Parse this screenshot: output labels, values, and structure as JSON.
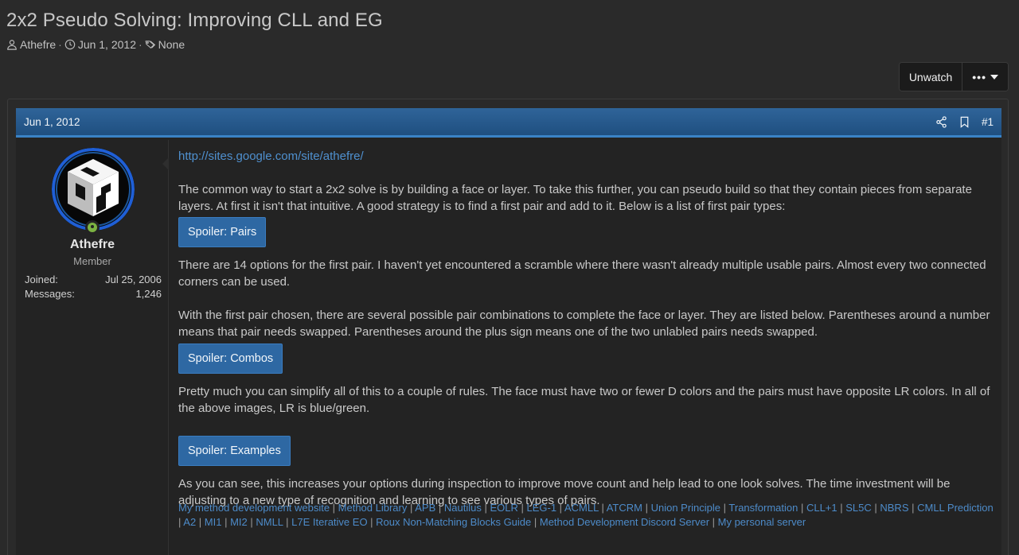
{
  "thread": {
    "title": "2x2 Pseudo Solving: Improving CLL and EG",
    "author": "Athefre",
    "date": "Jun 1, 2012",
    "tags": "None"
  },
  "actions": {
    "unwatch_label": "Unwatch"
  },
  "post": {
    "date": "Jun 1, 2012",
    "number": "#1",
    "user": {
      "name": "Athefre",
      "title": "Member",
      "joined_label": "Joined:",
      "joined_value": "Jul 25, 2006",
      "messages_label": "Messages:",
      "messages_value": "1,246"
    },
    "link": "http://sites.google.com/site/athefre/",
    "para1": "The common way to start a 2x2 solve is by building a face or layer. To take this further, you can pseudo build so that they contain pieces from separate layers. At first it isn't that intuitive. A good strategy is to find a first pair and add to it. Below is a list of first pair types:",
    "spoiler1": "Spoiler: Pairs",
    "para2": "There are 14 options for the first pair. I haven't yet encountered a scramble where there wasn't already multiple usable pairs. Almost every two connected corners can be used.",
    "para3": "With the first pair chosen, there are several possible pair combinations to complete the face or layer. They are listed below. Parentheses around a number means that pair needs swapped. Parentheses around the plus sign means one of the two unlabled pairs needs swapped.",
    "spoiler2": "Spoiler: Combos",
    "para4": "Pretty much you can simplify all of this to a couple of rules. The face must have two or fewer D colors and the pairs must have opposite LR colors. In all of the above images, LR is blue/green.",
    "spoiler3": "Spoiler: Examples",
    "para5": "As you can see, this increases your options during inspection to improve move count and help lead to one look solves. The time investment will be adjusting to a new type of recognition and learning to see various types of pairs.",
    "signature": [
      "My method development website",
      "Method Library",
      "APB",
      "Nautilus",
      "EOLR",
      "LEG-1",
      "ACMLL",
      "ATCRM",
      "Union Principle",
      "Transformation",
      "CLL+1",
      "SL5C",
      "NBRS",
      "CMLL Prediction",
      "A2",
      "MI1",
      "MI2",
      "NMLL",
      "L7E Iterative EO",
      "Roux Non-Matching Blocks Guide",
      "Method Development Discord Server",
      "My personal server"
    ]
  },
  "colors": {
    "background": "#2a2a2a",
    "header_blue": "#2f6499",
    "link_blue": "#4f90cf",
    "spoiler_blue": "#2e68a3",
    "online_green": "#7cb342"
  }
}
